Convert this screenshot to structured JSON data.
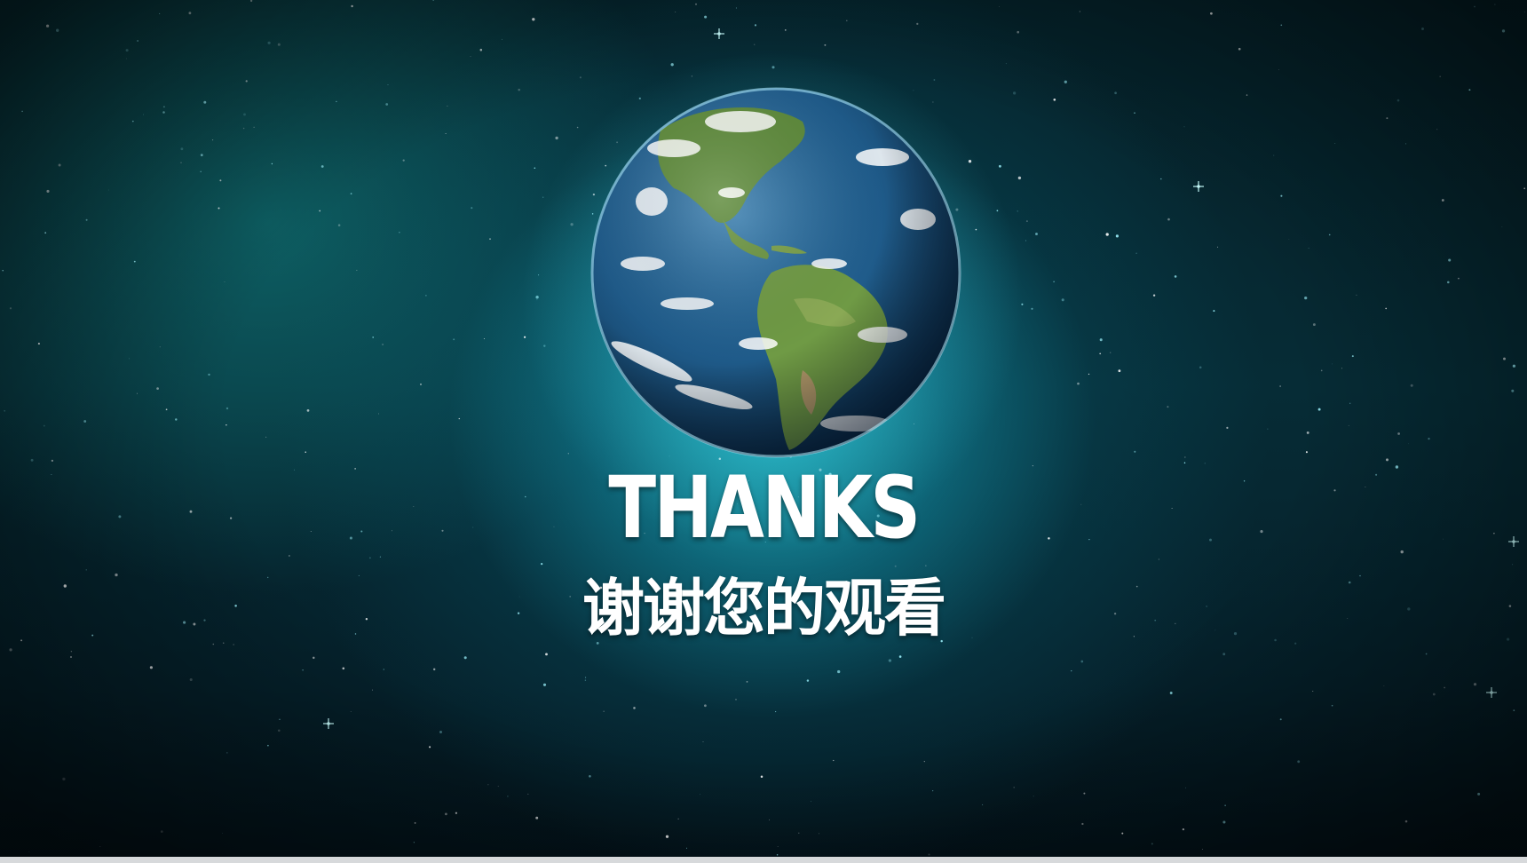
{
  "slide": {
    "title": "THANKS",
    "subtitle": "谢谢您的观看"
  },
  "colors": {
    "background_dark": "#041820",
    "glow_teal": "#28c8d7",
    "text": "#ffffff",
    "bottom_bar": "#d7d9db"
  },
  "icons": {
    "earth": "earth-globe-icon"
  }
}
